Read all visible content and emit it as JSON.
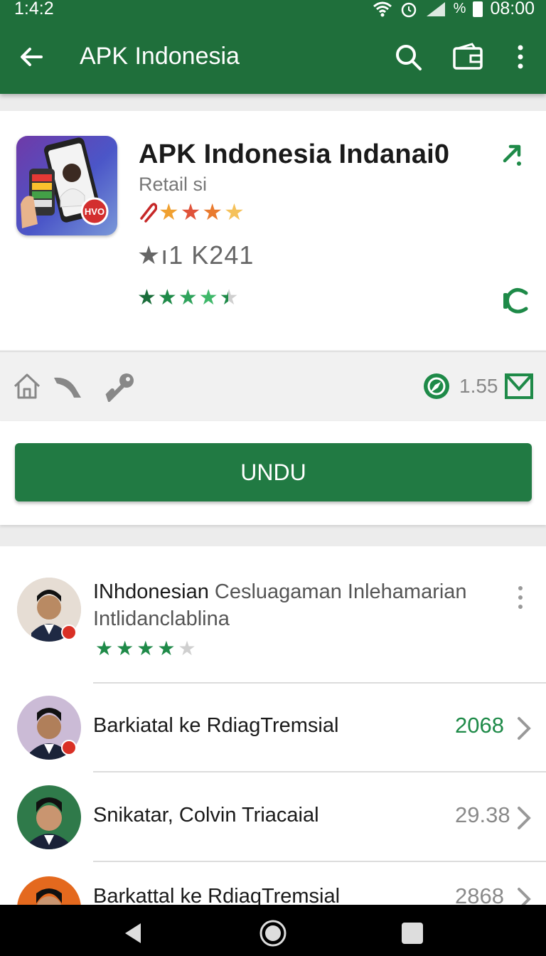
{
  "status_bar": {
    "time_left": "1:4:2",
    "percent": "%",
    "time_right": "08:00"
  },
  "app_bar": {
    "title": "APK Indonesia"
  },
  "app": {
    "name": "APK Indonesia Indanai0",
    "subtitle": "Retail si",
    "rating_top": 4.5,
    "count": "★ı1 K241",
    "rating_bottom": 4.5
  },
  "actions": {
    "count": "1.55"
  },
  "download": {
    "label": "UNDU"
  },
  "list": [
    {
      "title": "INhdonesian",
      "title_rest": " Cesluagaman Inlehamarian",
      "subtitle": "Intlidanclablina",
      "rating": 4
    },
    {
      "title": "Barkiatal ke RdiagTremsial",
      "value": "2068"
    },
    {
      "title": "Snikatar, Colvin Triacaial",
      "value": "29.38"
    },
    {
      "title": "Barkattal ke RdiaqTremsial",
      "value": "2868"
    }
  ],
  "colors": {
    "primary": "#1f6f3b",
    "button": "#217a43",
    "star_orange": "#f0a030",
    "star_green": "#1e8a48",
    "value_green": "#1e8a48"
  }
}
